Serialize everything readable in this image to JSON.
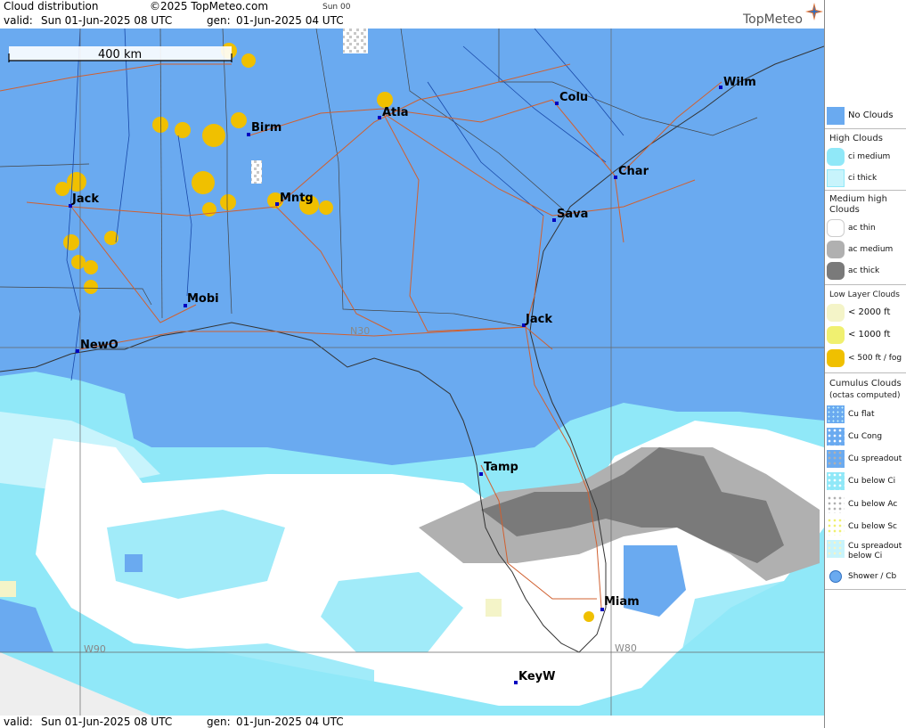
{
  "header": {
    "title": "Cloud distribution",
    "copyright": "©2025 TopMeteo.com",
    "run": "Sun 00",
    "valid_label": "valid:",
    "valid_value": "Sun  01-Jun-2025  08 UTC",
    "gen_label": "gen:",
    "gen_value": "01-Jun-2025 04 UTC",
    "brand": "TopMeteo"
  },
  "map": {
    "scale_label": "400 km",
    "grid_labels": {
      "lat_n30": "N30",
      "lon_w90": "W90",
      "lon_w80": "W80"
    },
    "cities": [
      {
        "name": "Wilm"
      },
      {
        "name": "Colu"
      },
      {
        "name": "Atla"
      },
      {
        "name": "Birm"
      },
      {
        "name": "Char"
      },
      {
        "name": "Jack"
      },
      {
        "name": "Mntg"
      },
      {
        "name": "Sava"
      },
      {
        "name": "Mobi"
      },
      {
        "name": "Jack"
      },
      {
        "name": "NewO"
      },
      {
        "name": "Tamp"
      },
      {
        "name": "Miam"
      },
      {
        "name": "KeyW"
      }
    ]
  },
  "legend": {
    "no_clouds": "No Clouds",
    "high_title": "High Clouds",
    "ci_medium": "ci medium",
    "ci_thick": "ci thick",
    "medium_title_1": "Medium high",
    "medium_title_2": "Clouds",
    "ac_thin": "ac thin",
    "ac_medium": "ac medium",
    "ac_thick": "ac thick",
    "low_title": "Low Layer Clouds",
    "low_2000": "< 2000 ft",
    "low_1000": "< 1000 ft",
    "low_500": "< 500 ft / fog",
    "cu_title_1": "Cumulus Clouds",
    "cu_title_2": "(octas computed)",
    "cu_flat": "Cu flat",
    "cu_cong": "Cu Cong",
    "cu_spreadout": "Cu spreadout",
    "cu_below_ci": "Cu below Ci",
    "cu_below_ac": "Cu below Ac",
    "cu_below_sc": "Cu below Sc",
    "cu_spread_ci_1": "Cu spreadout",
    "cu_spread_ci_2": "below Ci",
    "shower": "Shower / Cb"
  },
  "footer": {
    "valid_label": "valid:",
    "valid_value": "Sun  01-Jun-2025  08 UTC",
    "gen_label": "gen:",
    "gen_value": "01-Jun-2025 04 UTC"
  },
  "colors": {
    "no_clouds": "#6aaaf0",
    "ci_medium": "#90e8f8",
    "ci_thick": "#c8f4fc",
    "ac_thin": "#ffffff",
    "ac_medium": "#b0b0b0",
    "ac_thick": "#7a7a7a",
    "low_2000": "#f4f4c8",
    "low_1000": "#f0f070",
    "low_500": "#f0c000",
    "road": "#d06030",
    "border": "#444444",
    "outside": "#eeeeee"
  }
}
